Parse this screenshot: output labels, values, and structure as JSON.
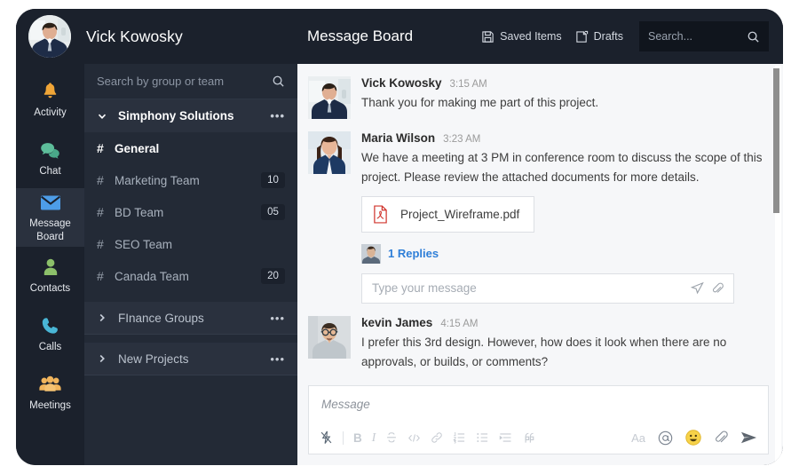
{
  "topbar": {
    "user_name": "Vick Kowosky",
    "board_title": "Message Board",
    "saved_items_label": "Saved Items",
    "drafts_label": "Drafts",
    "search_placeholder": "Search...",
    "background": "#1b212c"
  },
  "rail": {
    "items": [
      {
        "label": "Activity",
        "icon": "bell-icon",
        "color": "#f0a537",
        "active": false
      },
      {
        "label": "Chat",
        "icon": "chat-bubbles-icon",
        "color": "#5dbd9a",
        "active": false
      },
      {
        "label": "Message Board",
        "icon": "envelope-icon",
        "color": "#4d9de8",
        "active": true
      },
      {
        "label": "Contacts",
        "icon": "person-icon",
        "color": "#8cc06a",
        "active": false
      },
      {
        "label": "Calls",
        "icon": "phone-icon",
        "color": "#49b6d6",
        "active": false
      },
      {
        "label": "Meetings",
        "icon": "people-group-icon",
        "color": "#f0b45c",
        "active": false
      }
    ]
  },
  "channels": {
    "search_placeholder": "Search by group or team",
    "groups": [
      {
        "name": "Simphony Solutions",
        "expanded": true,
        "menu": "•••",
        "items": [
          {
            "name": "General",
            "badge": "",
            "active": true
          },
          {
            "name": "Marketing Team",
            "badge": "10",
            "active": false
          },
          {
            "name": "BD Team",
            "badge": "05",
            "active": false
          },
          {
            "name": "SEO Team",
            "badge": "",
            "active": false
          },
          {
            "name": "Canada Team",
            "badge": "20",
            "active": false
          }
        ]
      },
      {
        "name": "FInance  Groups",
        "expanded": false,
        "menu": "•••",
        "items": []
      },
      {
        "name": "New Projects",
        "expanded": false,
        "menu": "•••",
        "items": []
      }
    ]
  },
  "messages": [
    {
      "author": "Vick Kowosky",
      "time": "3:15 AM",
      "text": "Thank you for making me part of this project.",
      "attachment": null,
      "replies": null
    },
    {
      "author": "Maria Wilson",
      "time": "3:23 AM",
      "text": "We have a meeting at 3 PM in conference room to discuss the scope of this project.  Please review the attached documents for more details.",
      "attachment": {
        "filename": "Project_Wireframe.pdf",
        "icon": "pdf-file-icon"
      },
      "replies": {
        "label": "1 Replies",
        "reply_placeholder": "Type your message"
      }
    },
    {
      "author": "kevin James",
      "time": "4:15 AM",
      "text": "I prefer this 3rd design. However, how does it look when there are no approvals, or builds, or comments?",
      "attachment": null,
      "replies": null
    }
  ],
  "composer": {
    "placeholder": "Message",
    "left_tools": [
      "lightning-icon",
      "bold-icon",
      "italic-icon",
      "strikethrough-icon",
      "code-icon",
      "link-icon",
      "ordered-list-icon",
      "bullet-list-icon",
      "indent-icon",
      "blockquote-icon"
    ],
    "right_tools": [
      "text-format-icon",
      "mention-icon",
      "emoji-icon",
      "attach-icon",
      "send-icon"
    ]
  },
  "colors": {
    "rail_bg": "#1b212c",
    "channels_bg": "#232a36",
    "active_row": "#2a313e",
    "main_bg": "#f6f7f9",
    "link": "#2f7fd8",
    "pdf_red": "#d0342c"
  }
}
